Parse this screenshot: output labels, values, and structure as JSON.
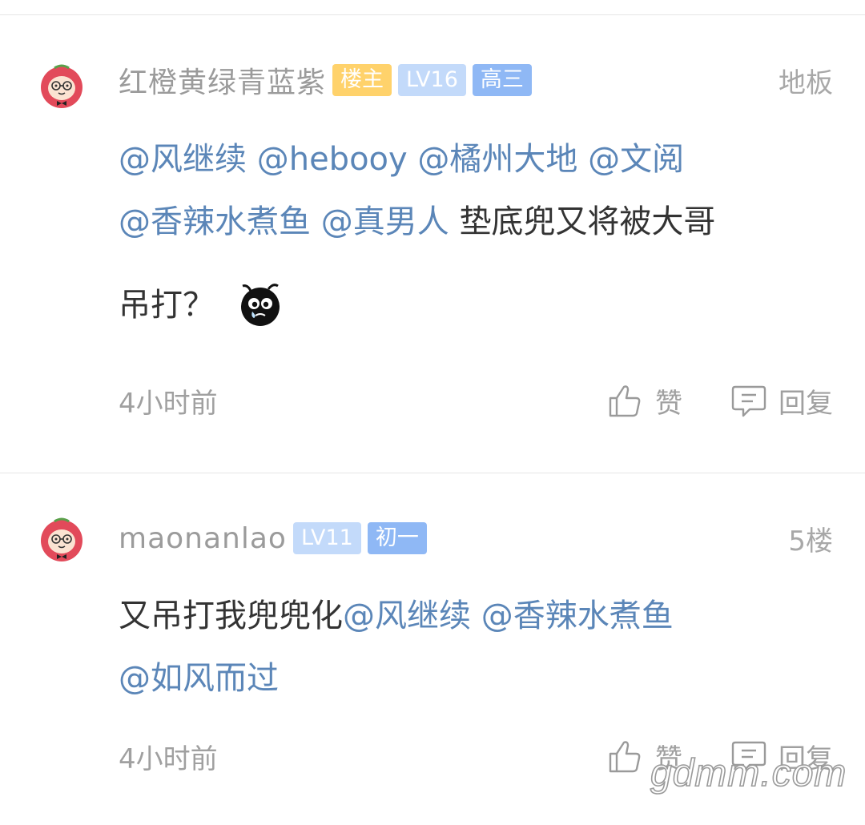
{
  "posts": [
    {
      "username": "红橙黄绿青蓝紫",
      "badges": {
        "owner": "楼主",
        "level": "LV16",
        "grade": "高三"
      },
      "floor": "地板",
      "lines": [
        [
          "@风继续",
          "@hebooy",
          "@橘州大地",
          "@文阅"
        ],
        [
          "@香辣水煮鱼",
          "@真男人"
        ],
        []
      ],
      "text_line2": "垫底兜又将被大哥",
      "text_line3": "吊打？",
      "emoji": "bomb-emoji",
      "time": "4小时前",
      "like_label": "赞",
      "reply_label": "回复"
    },
    {
      "username": "maonanlao",
      "badges": {
        "level": "LV11",
        "grade": "初一"
      },
      "floor": "5楼",
      "text_line1": "又吊打我兜兜化",
      "lines": [
        [
          "@风继续",
          "@香辣水煮鱼"
        ],
        [
          "@如风而过"
        ]
      ],
      "time": "4小时前",
      "like_label": "赞",
      "reply_label": "回复"
    }
  ],
  "watermark": "gdmm.com",
  "colors": {
    "mention": "#5b86b8",
    "badge_owner": "#ffd26b",
    "badge_level": "#c3dafa",
    "badge_grade": "#8fb8f5",
    "avatar_red": "#e24a5a"
  }
}
